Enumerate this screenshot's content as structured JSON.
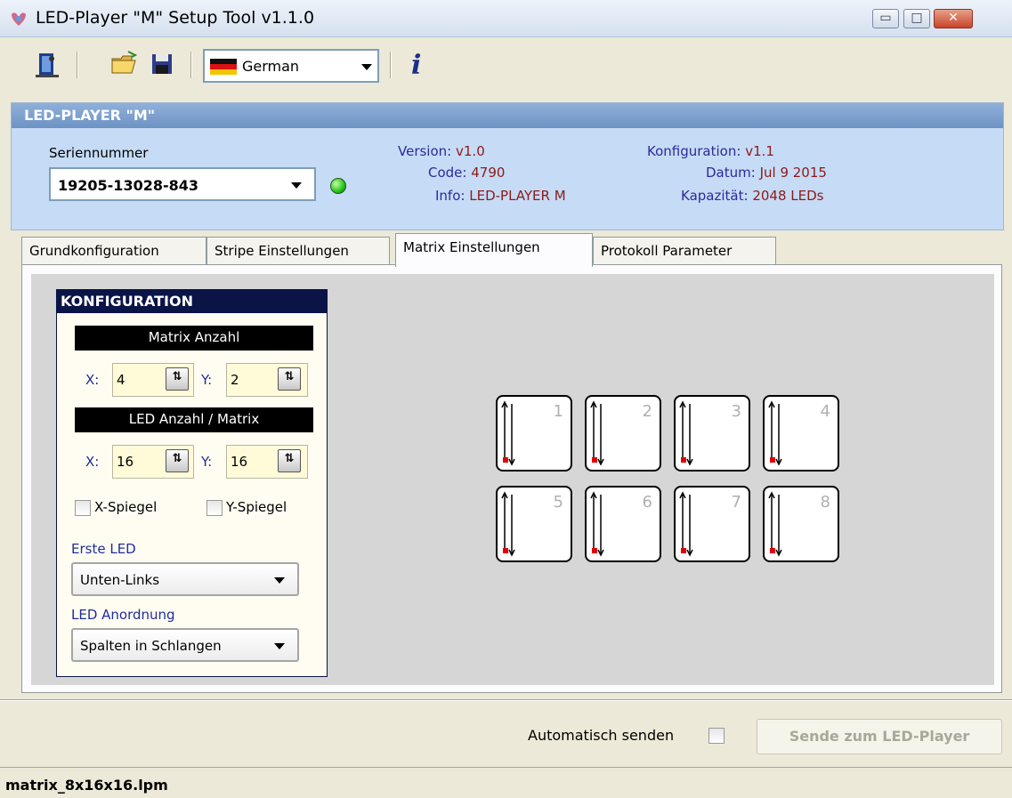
{
  "window": {
    "title": "LED-Player \"M\" Setup Tool v1.1.0",
    "minimize_glyph": "▭",
    "maximize_glyph": "□",
    "close_glyph": "✕"
  },
  "toolbar": {
    "language_selected": "German",
    "icons": [
      "exit-icon",
      "open-folder-icon",
      "save-disk-icon",
      "german-flag-icon",
      "info-icon"
    ],
    "info_glyph": "i"
  },
  "device": {
    "header": "LED-PLAYER \"M\"",
    "serial_label": "Seriennummer",
    "serial_value": "19205-13028-843",
    "version_label": "Version:",
    "version_value": "v1.0",
    "code_label": "Code:",
    "code_value": "4790",
    "info_label": "Info:",
    "info_value": "LED-PLAYER M",
    "config_label": "Konfiguration:",
    "config_value": "v1.1",
    "date_label": "Datum:",
    "date_value": "Jul  9 2015",
    "capacity_label": "Kapazität:",
    "capacity_value": "2048 LEDs",
    "status_color": "#25c21c"
  },
  "tabs": [
    {
      "label": "Grundkonfiguration",
      "active": false
    },
    {
      "label": "Stripe Einstellungen",
      "active": false
    },
    {
      "label": "Matrix Einstellungen",
      "active": true
    },
    {
      "label": "Protokoll Parameter",
      "active": false
    }
  ],
  "konfiguration": {
    "title": "KONFIGURATION",
    "matrix_count_header": "Matrix Anzahl",
    "matrix_x_label": "X:",
    "matrix_x_value": "4",
    "matrix_y_label": "Y:",
    "matrix_y_value": "2",
    "led_count_header": "LED Anzahl / Matrix",
    "led_x_label": "X:",
    "led_x_value": "16",
    "led_y_label": "Y:",
    "led_y_value": "16",
    "x_mirror_label": "X-Spiegel",
    "y_mirror_label": "Y-Spiegel",
    "first_led_label": "Erste LED",
    "first_led_value": "Unten-Links",
    "arrangement_label": "LED Anordnung",
    "arrangement_value": "Spalten in Schlangen"
  },
  "matrix": {
    "cells": [
      "1",
      "2",
      "3",
      "4",
      "5",
      "6",
      "7",
      "8"
    ],
    "start_marker_color": "#e00000"
  },
  "footer": {
    "auto_send_label": "Automatisch senden",
    "send_button": "Sende zum LED-Player",
    "status_file": "matrix_8x16x16.lpm"
  }
}
